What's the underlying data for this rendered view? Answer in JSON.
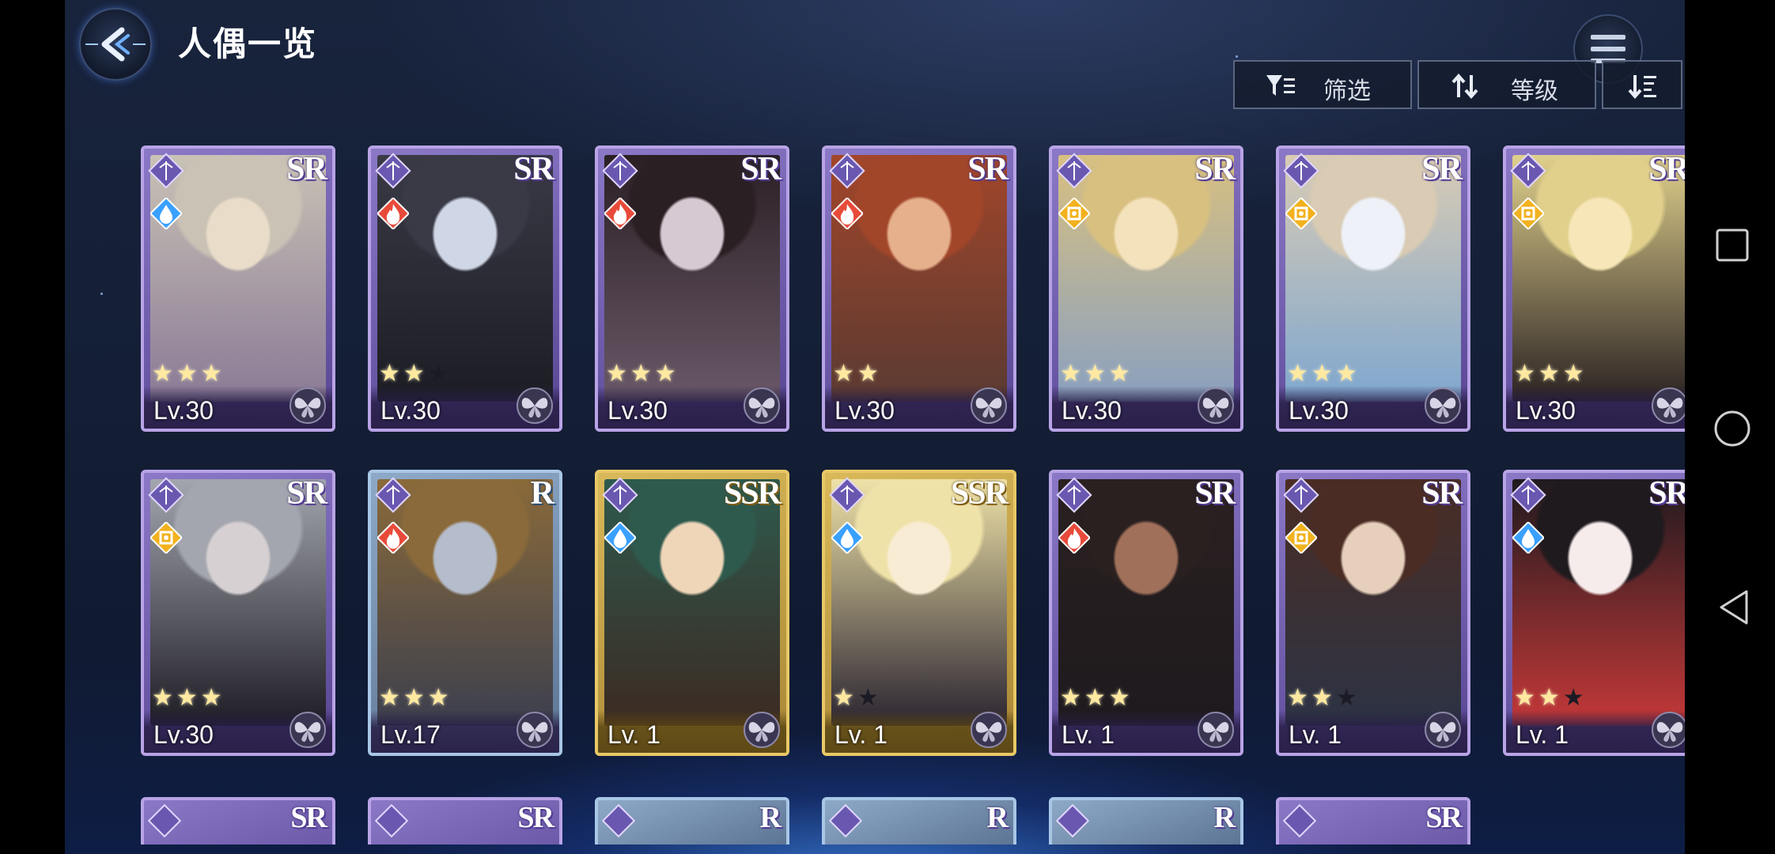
{
  "header": {
    "title": "人偶一览",
    "back_icon": "back-arrow-icon",
    "menu_icon": "hamburger-menu-icon"
  },
  "toolbar": {
    "filter_label": "筛选",
    "sort_label": "等级",
    "order_icon": "sort-descending-icon"
  },
  "cards": [
    {
      "rarity": "SR",
      "level": "Lv.30",
      "element": "water",
      "stars_on": 3,
      "stars_total": 3
    },
    {
      "rarity": "SR",
      "level": "Lv.30",
      "element": "fire",
      "stars_on": 2,
      "stars_total": 3
    },
    {
      "rarity": "SR",
      "level": "Lv.30",
      "element": "fire",
      "stars_on": 3,
      "stars_total": 3
    },
    {
      "rarity": "SR",
      "level": "Lv.30",
      "element": "fire",
      "stars_on": 2,
      "stars_total": 2
    },
    {
      "rarity": "SR",
      "level": "Lv.30",
      "element": "light",
      "stars_on": 3,
      "stars_total": 3
    },
    {
      "rarity": "SR",
      "level": "Lv.30",
      "element": "light",
      "stars_on": 3,
      "stars_total": 3
    },
    {
      "rarity": "SR",
      "level": "Lv.30",
      "element": "light",
      "stars_on": 3,
      "stars_total": 3
    },
    {
      "rarity": "SR",
      "level": "Lv.30",
      "element": "light",
      "stars_on": 3,
      "stars_total": 3
    },
    {
      "rarity": "R",
      "level": "Lv.17",
      "element": "fire",
      "stars_on": 3,
      "stars_total": 3
    },
    {
      "rarity": "SSR",
      "level": "Lv. 1",
      "element": "water",
      "stars_on": 0,
      "stars_total": 0
    },
    {
      "rarity": "SSR",
      "level": "Lv. 1",
      "element": "water",
      "stars_on": 1,
      "stars_total": 2
    },
    {
      "rarity": "SR",
      "level": "Lv. 1",
      "element": "fire",
      "stars_on": 3,
      "stars_total": 3
    },
    {
      "rarity": "SR",
      "level": "Lv. 1",
      "element": "light",
      "stars_on": 2,
      "stars_total": 3
    },
    {
      "rarity": "SR",
      "level": "Lv. 1",
      "element": "water",
      "stars_on": 2,
      "stars_total": 3
    }
  ],
  "peek_cards": [
    {
      "rarity": "SR"
    },
    {
      "rarity": "SR"
    },
    {
      "rarity": "R"
    },
    {
      "rarity": "R"
    },
    {
      "rarity": "R"
    },
    {
      "rarity": "SR"
    }
  ],
  "system_nav": {
    "recents_icon": "square-recents-icon",
    "home_icon": "circle-home-icon",
    "back_icon": "triangle-back-icon"
  },
  "colors": {
    "sr_frame": "#b8a3e6",
    "ssr_frame": "#e8c866",
    "r_frame": "#a8c6e6",
    "water": "#3aa0ff",
    "fire": "#e84a3a",
    "light": "#f2b21e"
  }
}
